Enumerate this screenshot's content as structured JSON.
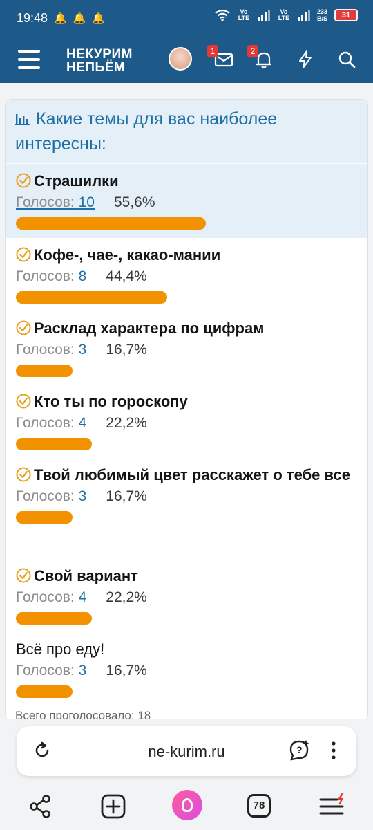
{
  "status_bar": {
    "time": "19:48",
    "network_1": "Vo LTE",
    "network_2": "Vo LTE",
    "speed_value": "233",
    "speed_unit": "B/S",
    "battery": "31"
  },
  "header": {
    "logo_line1": "НЕКУРИМ",
    "logo_line2": "НЕПЬЁМ",
    "messages_badge": "1",
    "notifications_badge": "2",
    "icons": [
      "menu-icon",
      "mail-icon",
      "bell-icon",
      "lightning-icon",
      "search-icon"
    ]
  },
  "poll": {
    "title": "Какие темы для вас наиболее интересны:",
    "votes_label": "Голосов:",
    "options": [
      {
        "label": "Страшилки",
        "votes": "10",
        "percent": "55,6%",
        "share": 0.556,
        "checked": true,
        "selected": true
      },
      {
        "label": "Кофе-, чае-, какао-мании",
        "votes": "8",
        "percent": "44,4%",
        "share": 0.444,
        "checked": true,
        "selected": false
      },
      {
        "label": "Расклад характера по цифрам",
        "votes": "3",
        "percent": "16,7%",
        "share": 0.167,
        "checked": true,
        "selected": false
      },
      {
        "label": "Кто ты по гороскопу",
        "votes": "4",
        "percent": "22,2%",
        "share": 0.222,
        "checked": true,
        "selected": false
      },
      {
        "label": "Твой любимый цвет расскажет о тебе все",
        "votes": "3",
        "percent": "16,7%",
        "share": 0.167,
        "checked": true,
        "selected": false
      },
      {
        "label": "Свой вариант",
        "votes": "4",
        "percent": "22,2%",
        "share": 0.222,
        "checked": true,
        "selected": false
      },
      {
        "label": "Всё про еду!",
        "votes": "3",
        "percent": "16,7%",
        "share": 0.167,
        "checked": false,
        "selected": false
      }
    ],
    "total_text": "Всего проголосовало: 18"
  },
  "browser": {
    "url": "ne-kurim.ru",
    "tabs_count": "78"
  },
  "colors": {
    "header_bg": "#1d5a8a",
    "accent_blue": "#1d6fa5",
    "bar_orange": "#f39200",
    "check_orange": "#e8a020",
    "badge_red": "#e53935"
  }
}
